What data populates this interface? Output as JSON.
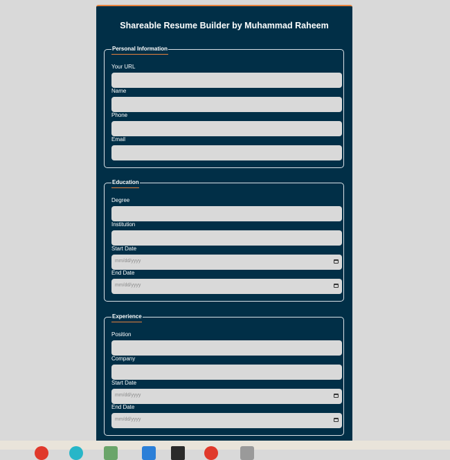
{
  "app": {
    "title": "Shareable Resume Builder by Muhammad Raheem"
  },
  "sections": {
    "personal": {
      "legend": "Personal Information",
      "url_label": "Your URL",
      "name_label": "Name",
      "phone_label": "Phone",
      "email_label": "Email"
    },
    "education": {
      "legend": "Education",
      "degree_label": "Degree",
      "institution_label": "Institution",
      "start_label": "Start Date",
      "end_label": "End Date",
      "date_placeholder": "mm/dd/yyyy"
    },
    "experience": {
      "legend": "Experience",
      "position_label": "Position",
      "company_label": "Company",
      "start_label": "Start Date",
      "end_label": "End Date",
      "date_placeholder": "mm/dd/yyyy"
    }
  },
  "colors": {
    "card_bg": "#012f47",
    "accent": "#e8823c",
    "field_bg": "#d9d9d9",
    "page_bg": "#d9d9d9"
  },
  "icons": [
    "calendar-icon",
    "taskbar-app-icon"
  ]
}
